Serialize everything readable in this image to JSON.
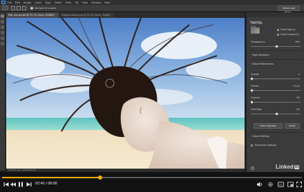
{
  "menubar": {
    "items": [
      "File",
      "Edit",
      "Image",
      "Layer",
      "Type",
      "Select",
      "Filter",
      "3D",
      "View",
      "Window",
      "Help"
    ]
  },
  "options": {
    "sample_label": "Sample All Layers",
    "select_mask_label": "Select and Mask..."
  },
  "tabs": [
    {
      "label": "Hair pre-op.psd @ 33.7% (Scan, RGB/8*)"
    },
    {
      "label": "Tropical beaux.psd @ 33.3% (Scan, RGB/8)"
    }
  ],
  "status": {
    "text": "33.33%   Doc: 18.6M/18.6M"
  },
  "properties": {
    "tab": "Properties",
    "view_mode_label": "View Mode",
    "view_label": "View:",
    "show_edge": "Show Edge (J)",
    "show_original": "Show Original (P)",
    "transparency_label": "Transparency",
    "transparency_value": "50%",
    "transparency_level": 0.5,
    "edge_detection": "Edge Detection",
    "global_refinements": "Global Refinements",
    "smooth_label": "Smooth",
    "smooth_value": "0",
    "smooth_level": 0.0,
    "feather_label": "Feather",
    "feather_value": "0.0 px",
    "feather_level": 0.0,
    "contrast_label": "Contrast",
    "contrast_value": "0%",
    "contrast_level": 0.0,
    "shift_edge_label": "Shift Edge",
    "shift_edge_value": "0%",
    "shift_edge_level": 0.5,
    "clear_selection": "Clear Selection",
    "invert": "Invert",
    "output_settings": "Output Settings",
    "remember_settings": "Remember Settings"
  },
  "watermark": {
    "text": "Linked",
    "badge": "in"
  },
  "player": {
    "time": "02:40 / 08:08",
    "progress": 0.328,
    "accent": "#f2b100",
    "icons": [
      "previous-icon",
      "rewind-icon",
      "pause-icon",
      "forward-icon",
      "next-icon",
      "volume-icon",
      "settings-icon",
      "captions-icon",
      "picture-in-picture-icon",
      "fullscreen-icon"
    ]
  }
}
